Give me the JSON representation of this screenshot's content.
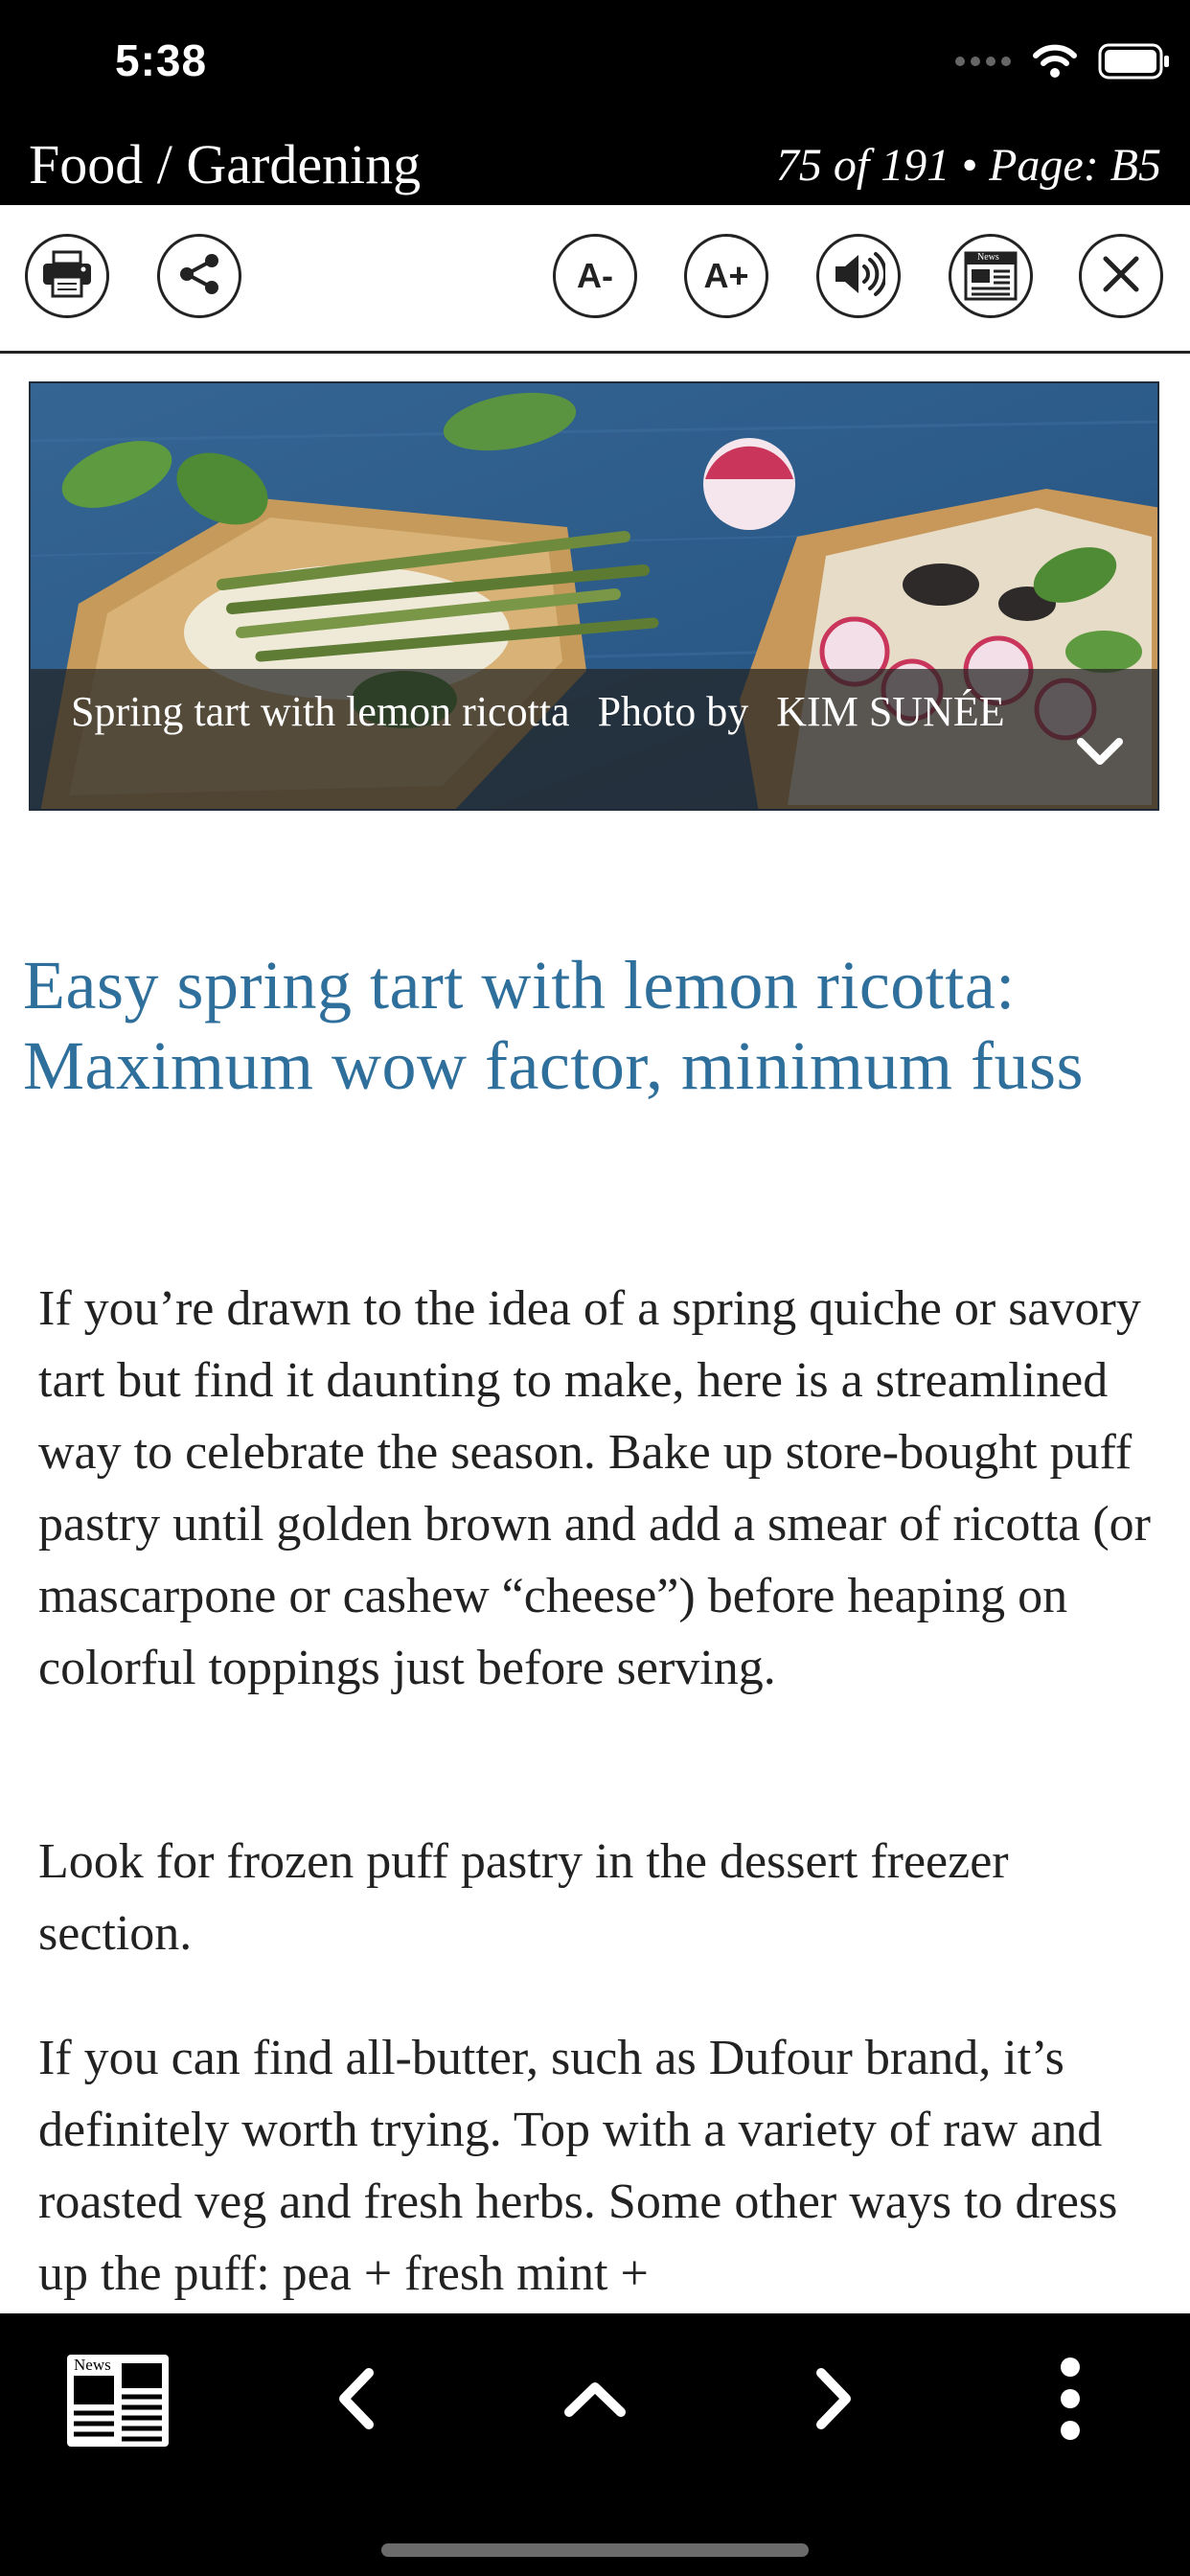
{
  "status": {
    "time": "5:38",
    "signal_icon": "signal-dots-icon",
    "wifi_icon": "wifi-icon",
    "battery_icon": "battery-icon"
  },
  "header": {
    "section": "Food / Gardening",
    "position": "75 of 191",
    "separator": "•",
    "page_label": "Page: B5"
  },
  "toolbar": {
    "print_icon": "printer-icon",
    "share_icon": "share-icon",
    "font_smaller_label": "A-",
    "font_larger_label": "A+",
    "audio_icon": "speaker-icon",
    "news_icon": "newspaper-icon",
    "news_label": "News",
    "close_icon": "close-icon"
  },
  "hero": {
    "caption": "Spring tart with lemon ricotta",
    "credit_prefix": "Photo by",
    "credit_name": "KIM SUNÉE",
    "expand_icon": "chevron-down-icon"
  },
  "article": {
    "headline": "Easy spring tart with lemon ricotta: Maximum wow factor, minimum fuss",
    "paragraphs": [
      "If you’re drawn to the idea of a spring quiche or savory tart but find it daunting to make, here is a streamlined way to celebrate the season. Bake up store-bought puff pastry until golden brown and add a smear of ricotta (or mascarpone or cashew “cheese”) before heaping on colorful toppings just before serving.",
      "Look for frozen puff pastry in the dessert freezer section.",
      "If you can find all-butter, such as Dufour brand, it’s definitely worth trying. Top with a variety of raw and roasted veg and fresh herbs. Some other ways to dress up the puff: pea + fresh mint +"
    ]
  },
  "bottom_nav": {
    "sections_icon": "newspaper-icon",
    "sections_label": "News",
    "prev_icon": "chevron-left-icon",
    "up_icon": "chevron-up-icon",
    "next_icon": "chevron-right-icon",
    "more_icon": "more-vertical-icon"
  },
  "colors": {
    "headline": "#2f6f9b",
    "bar_background": "#000000",
    "body_text": "#222222"
  }
}
